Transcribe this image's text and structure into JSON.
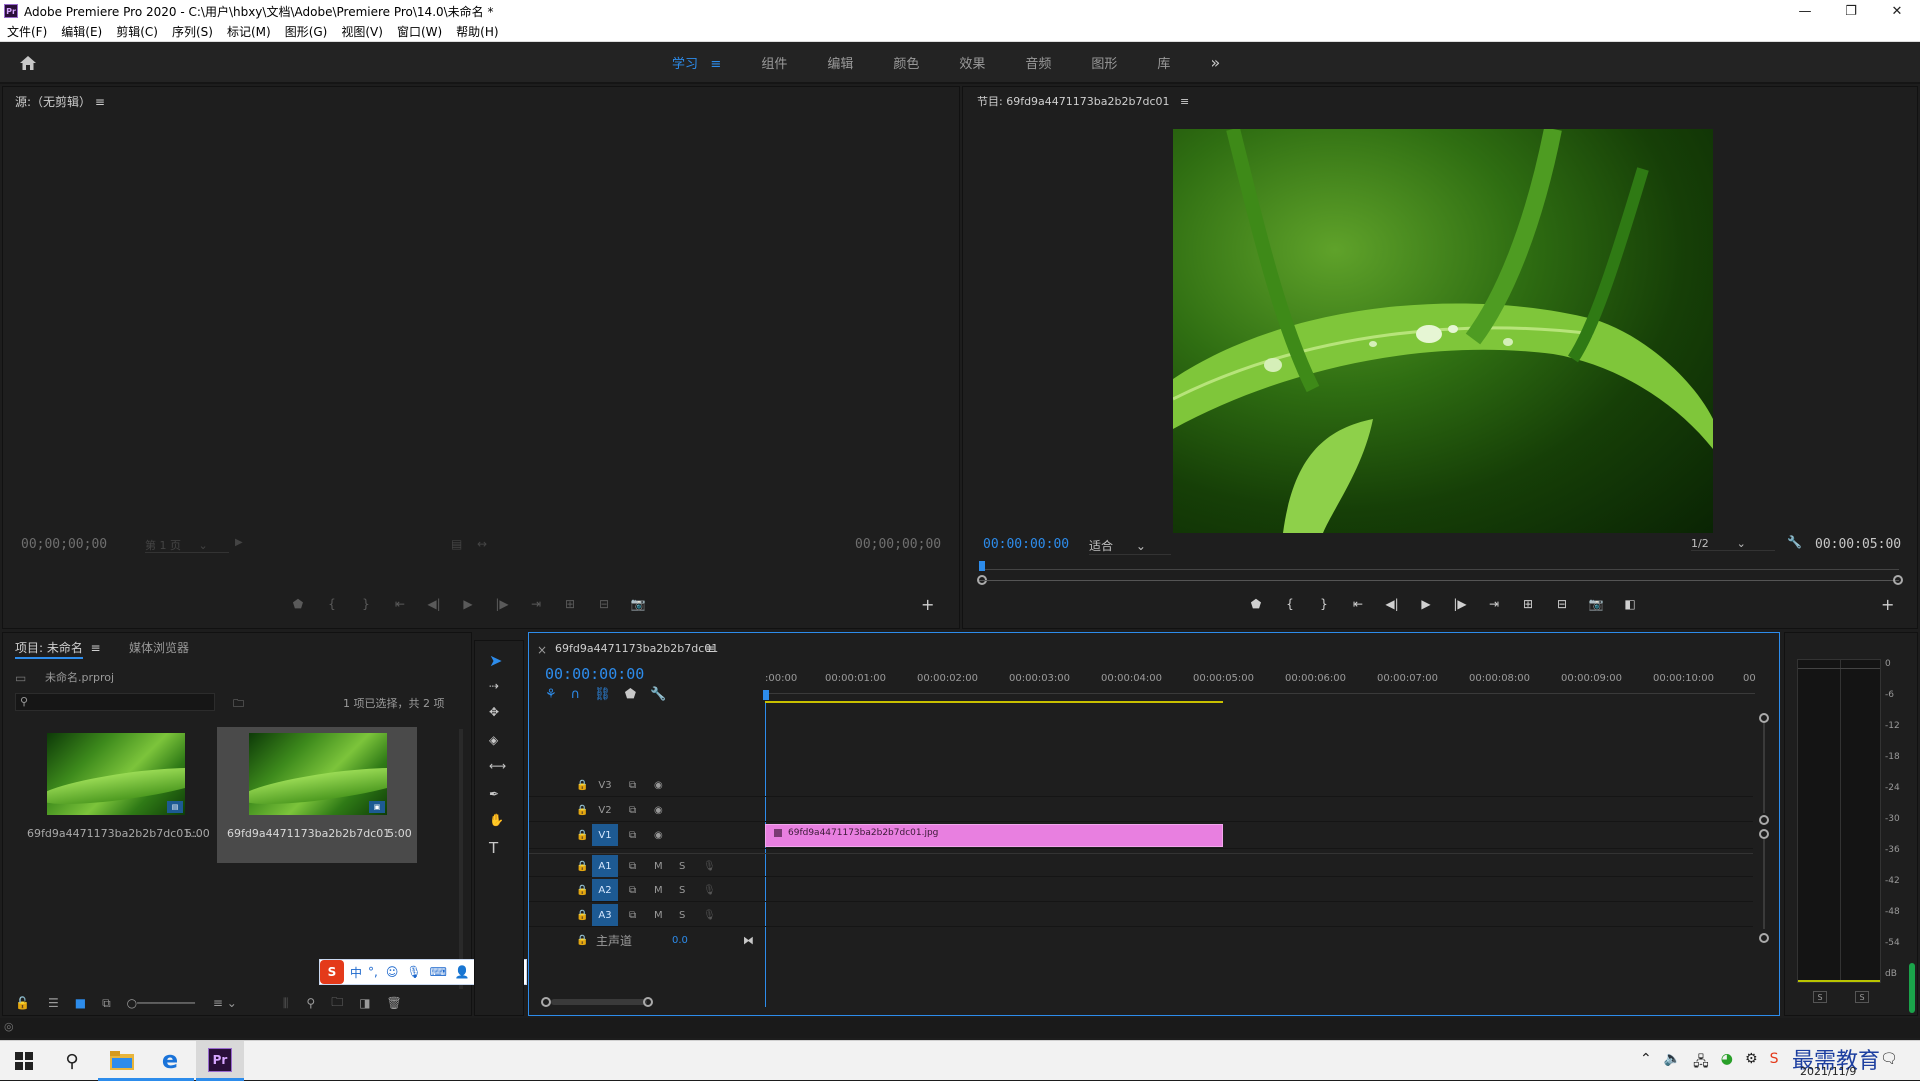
{
  "window": {
    "title": "Adobe Premiere Pro 2020 - C:\\用户\\hbxy\\文档\\Adobe\\Premiere Pro\\14.0\\未命名 *",
    "logo_text": "Pr",
    "minimize": "—",
    "restore": "❐",
    "close": "✕"
  },
  "menu": [
    "文件(F)",
    "编辑(E)",
    "剪辑(C)",
    "序列(S)",
    "标记(M)",
    "图形(G)",
    "视图(V)",
    "窗口(W)",
    "帮助(H)"
  ],
  "workspaces": {
    "tabs": [
      "学习",
      "组件",
      "编辑",
      "颜色",
      "效果",
      "音频",
      "图形",
      "库"
    ],
    "active_index": 0,
    "more": "»"
  },
  "source_monitor": {
    "title": "源:（无剪辑）",
    "menu": "≡",
    "timecode_left": "00;00;00;00",
    "page_select": "第 1 页",
    "timecode_right": "00;00;00;00",
    "add": "+"
  },
  "program_monitor": {
    "title": "节目: 69fd9a4471173ba2b2b7dc01",
    "menu": "≡",
    "timecode": "00:00:00:00",
    "fit_label": "适合",
    "resolution": "1/2",
    "duration": "00:00:05:00",
    "add": "+"
  },
  "project_panel": {
    "tab_project": "项目: 未命名",
    "menu": "≡",
    "tab_media": "媒体浏览器",
    "project_file": "未命名.prproj",
    "selection_info": "1 项已选择，共 2 项",
    "items": [
      {
        "name": "69fd9a4471173ba2b2b7dc01...",
        "duration": "5:00"
      },
      {
        "name": "69fd9a4471173ba2b2b7dc01",
        "duration": "5:00"
      }
    ]
  },
  "ime_toolbar": {
    "logo": "S",
    "lang": "中",
    "punct": "°,"
  },
  "timeline": {
    "close": "×",
    "sequence_name": "69fd9a4471173ba2b2b7dc01",
    "menu": "≡",
    "timecode": "00:00:00:00",
    "ruler_labels": [
      ":00:00",
      "00:00:01:00",
      "00:00:02:00",
      "00:00:03:00",
      "00:00:04:00",
      "00:00:05:00",
      "00:00:06:00",
      "00:00:07:00",
      "00:00:08:00",
      "00:00:09:00",
      "00:00:10:00",
      "00"
    ],
    "video_tracks": [
      "V3",
      "V2",
      "V1"
    ],
    "audio_tracks": [
      "A1",
      "A2",
      "A3"
    ],
    "mute_label": "M",
    "solo_label": "S",
    "master_label": "主声道",
    "master_value": "0.0",
    "clip_name": "69fd9a4471173ba2b2b7dc01.jpg",
    "clip_color": "#e87fe0"
  },
  "audio_meter": {
    "scale": [
      "0",
      "-6",
      "-12",
      "-18",
      "-24",
      "-30",
      "-36",
      "-42",
      "-48",
      "-54",
      "dB"
    ],
    "solo_left": "S",
    "solo_right": "S"
  },
  "taskbar": {
    "date": "2021/11/9",
    "watermark": "最需教育",
    "app_label": "Pr"
  },
  "colors": {
    "accent": "#2d8ceb",
    "panel_bg": "#1e1e1e",
    "clip": "#e87fe0"
  }
}
